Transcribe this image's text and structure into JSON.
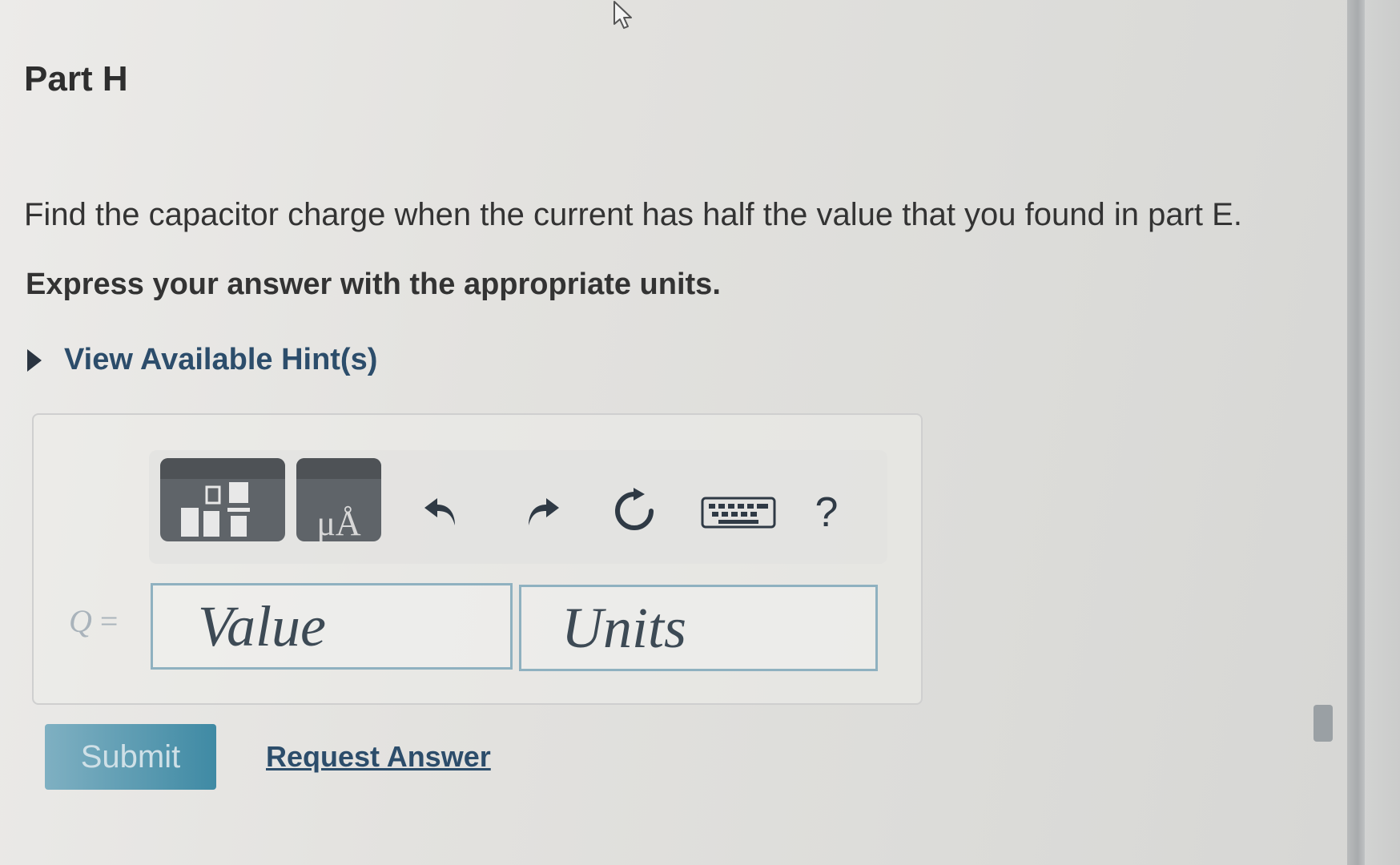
{
  "part": {
    "title": "Part H"
  },
  "question": {
    "text": "Find the capacitor charge when the current has half the value that you found in part E.",
    "instruction": "Express your answer with the appropriate units."
  },
  "hints": {
    "label": "View Available Hint(s)"
  },
  "toolbar": {
    "templates_icon": "templates-icon",
    "units_icon": "units-icon",
    "units_glyph": "μÅ",
    "undo_icon": "undo-icon",
    "redo_icon": "redo-icon",
    "reset_icon": "reset-icon",
    "keyboard_icon": "keyboard-icon",
    "help_label": "?"
  },
  "answer": {
    "variable": "Q",
    "equals": "=",
    "value_placeholder": "Value",
    "units_placeholder": "Units"
  },
  "actions": {
    "submit_label": "Submit",
    "request_answer_label": "Request Answer"
  },
  "colors": {
    "link": "#2c4d6b",
    "submit_start": "#7fb0c2",
    "submit_end": "#3f8aa4",
    "input_border": "#8fb1c0",
    "tool_button": "#5f6469"
  }
}
